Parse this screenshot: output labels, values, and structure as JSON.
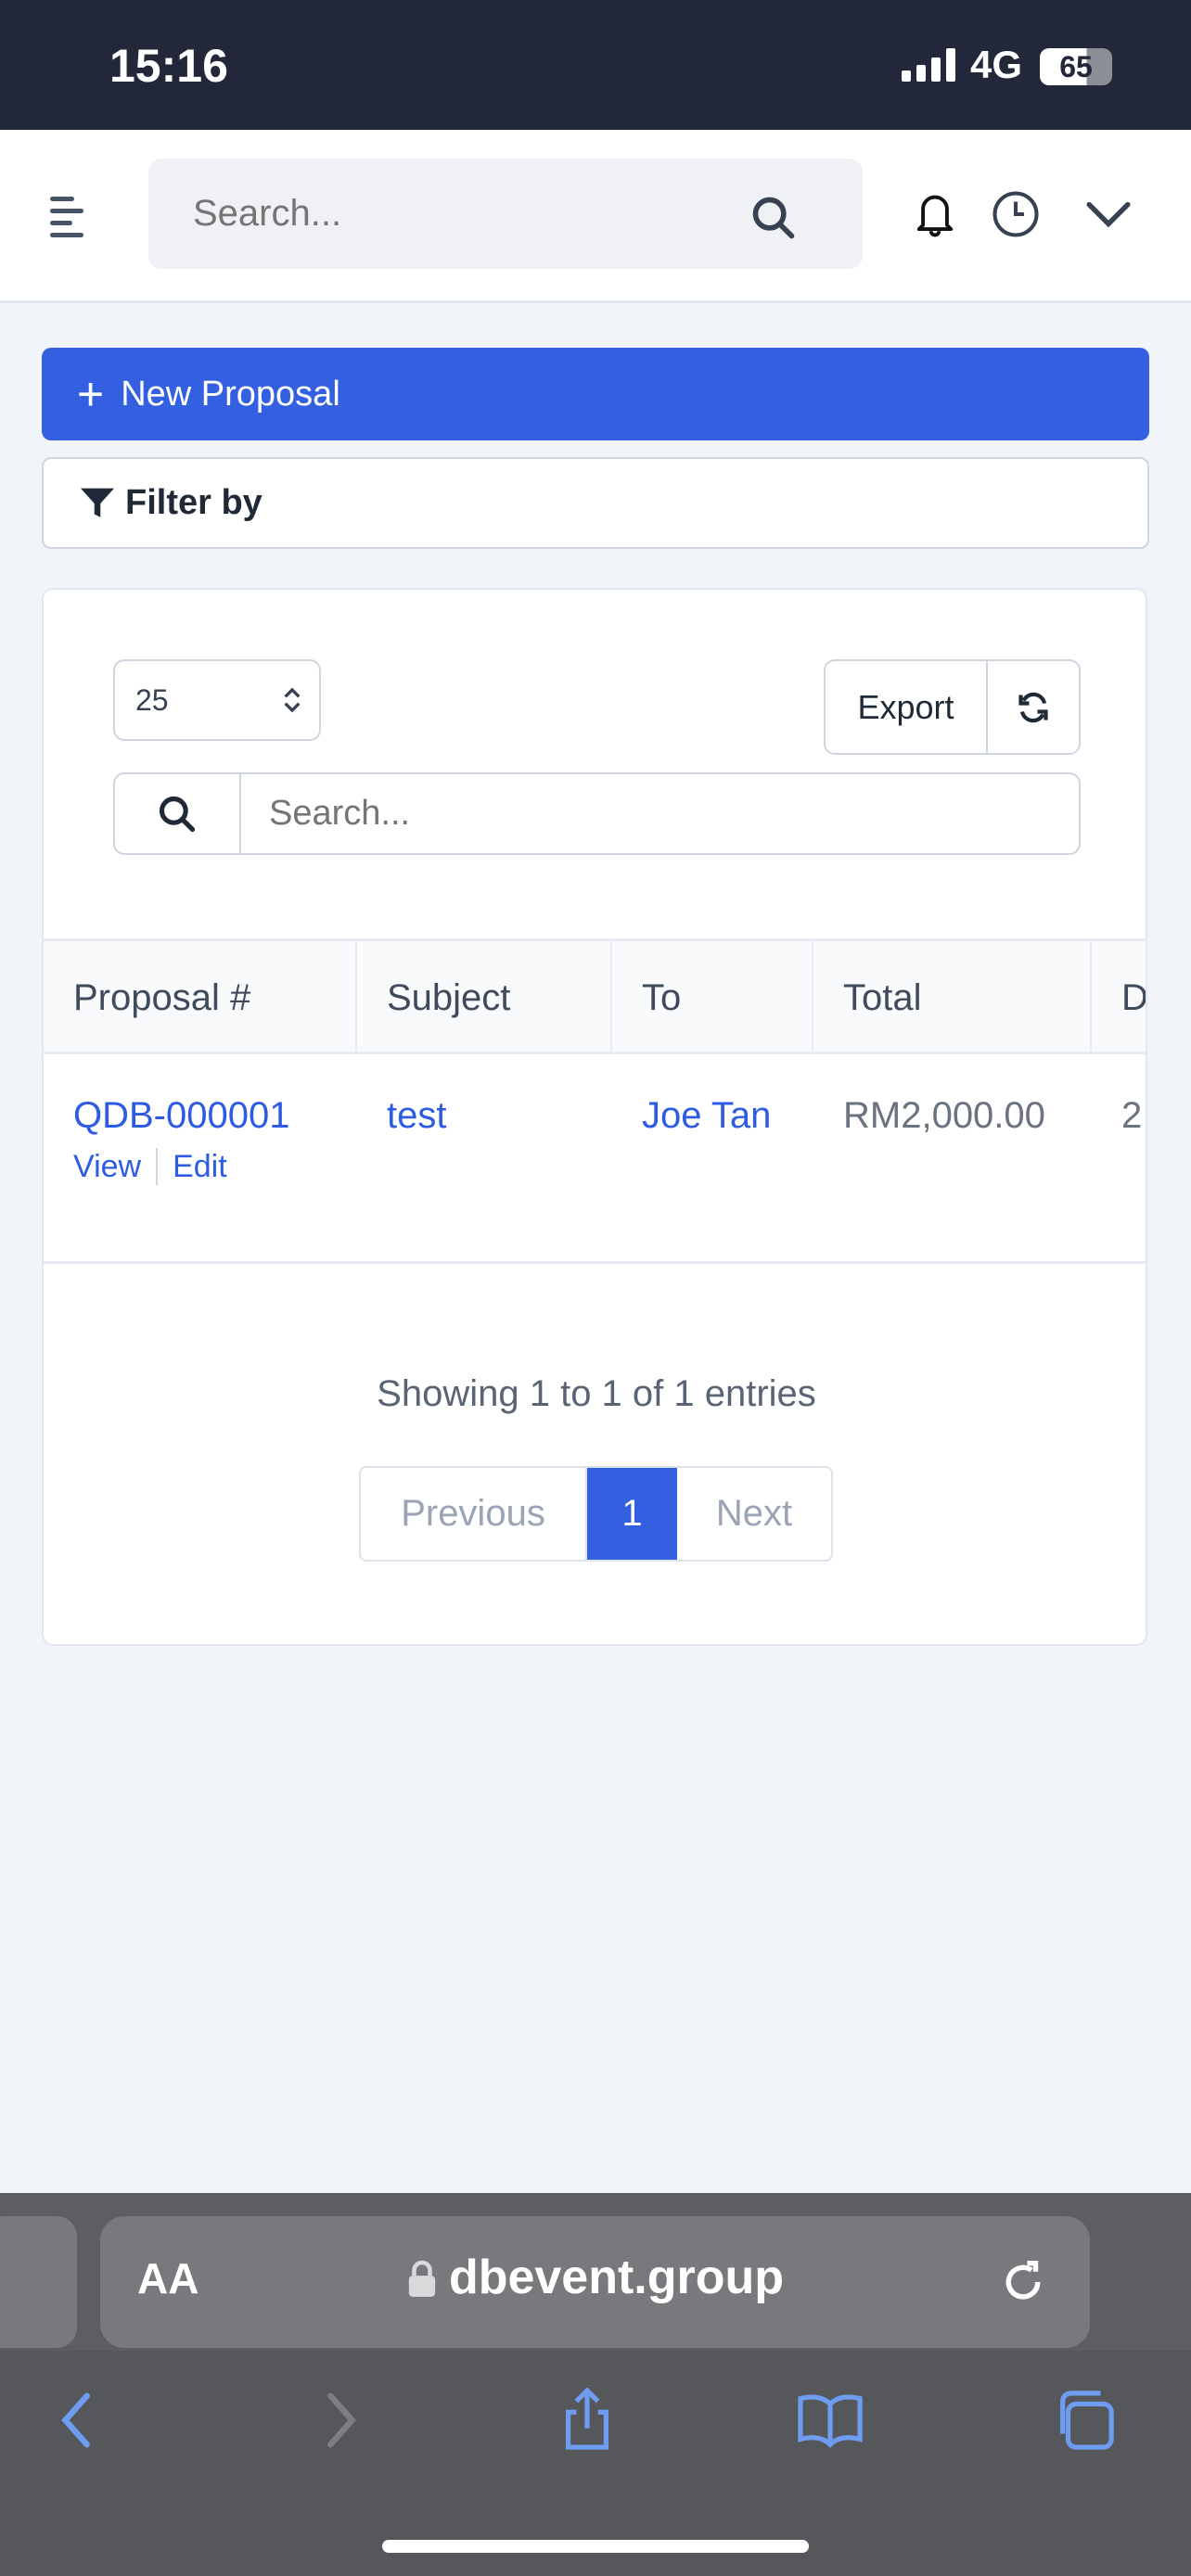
{
  "status": {
    "time": "15:16",
    "network": "4G",
    "battery": "65"
  },
  "header": {
    "search_placeholder": "Search..."
  },
  "actions": {
    "new_proposal": "New Proposal",
    "filter": "Filter by"
  },
  "table_controls": {
    "page_length": "25",
    "export": "Export",
    "search_placeholder": "Search..."
  },
  "table": {
    "columns": [
      "Proposal #",
      "Subject",
      "To",
      "Total",
      "D"
    ],
    "rows": [
      {
        "number": "QDB-000001",
        "subject": "test",
        "to": "Joe Tan",
        "total": "RM2,000.00",
        "date_partial": "2",
        "view": "View",
        "edit": "Edit"
      }
    ]
  },
  "pagination": {
    "info": "Showing 1 to 1 of 1 entries",
    "previous": "Previous",
    "current": "1",
    "next": "Next"
  },
  "browser": {
    "aa": "AA",
    "domain": "dbevent.group"
  },
  "colors": {
    "primary": "#3360e1",
    "status_bar": "#222839"
  }
}
